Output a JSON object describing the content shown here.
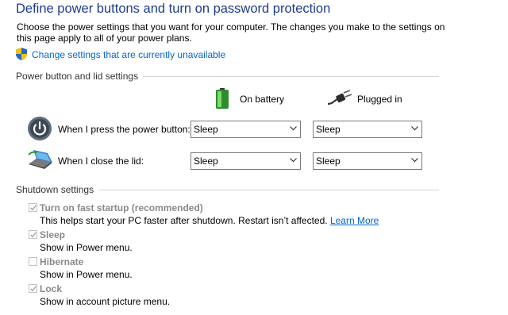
{
  "header": {
    "title": "Define power buttons and turn on password protection",
    "description": "Choose the power settings that you want for your computer. The changes you make to the settings on this page apply to all of your power plans.",
    "change_link": "Change settings that are currently unavailable"
  },
  "power_section": {
    "label": "Power button and lid settings",
    "columns": {
      "battery": "On battery",
      "plugged": "Plugged in"
    },
    "rows": [
      {
        "label": "When I press the power button:",
        "battery_value": "Sleep",
        "plugged_value": "Sleep"
      },
      {
        "label": "When I close the lid:",
        "battery_value": "Sleep",
        "plugged_value": "Sleep"
      }
    ]
  },
  "shutdown_section": {
    "label": "Shutdown settings",
    "options": [
      {
        "label": "Turn on fast startup (recommended)",
        "checked": true,
        "description": "This helps start your PC faster after shutdown. Restart isn’t affected.",
        "link": "Learn More"
      },
      {
        "label": "Sleep",
        "checked": true,
        "description": "Show in Power menu."
      },
      {
        "label": "Hibernate",
        "checked": false,
        "description": "Show in Power menu."
      },
      {
        "label": "Lock",
        "checked": true,
        "description": "Show in account picture menu."
      }
    ]
  },
  "colors": {
    "title": "#1e3c8c",
    "link": "#0066cc",
    "disabled_text": "#8a8a8a"
  }
}
